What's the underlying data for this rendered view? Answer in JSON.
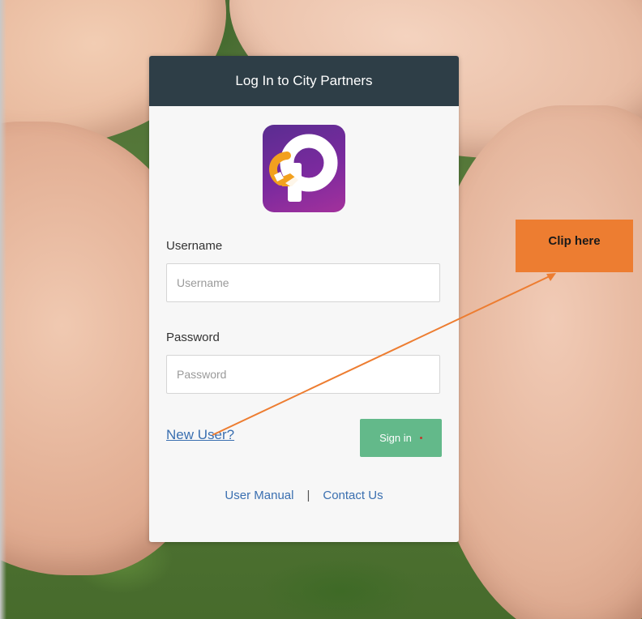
{
  "card": {
    "title": "Log In to City Partners",
    "header_color": "#2e3e47"
  },
  "logo": {
    "icon": "city-partners-handshake-logo",
    "colors": {
      "primary": "#6a2c97",
      "accent": "#f2a01e",
      "mark": "#ffffff"
    }
  },
  "form": {
    "username": {
      "label": "Username",
      "placeholder": "Username",
      "value": ""
    },
    "password": {
      "label": "Password",
      "placeholder": "Password",
      "value": ""
    },
    "new_user_link": "New User?",
    "sign_in_label": "Sign in",
    "sign_in_color": "#63b98a"
  },
  "footer": {
    "user_manual": "User Manual",
    "separator": "|",
    "contact_us": "Contact Us"
  },
  "annotation": {
    "text": "Clip here",
    "color": "#ed7d31"
  }
}
